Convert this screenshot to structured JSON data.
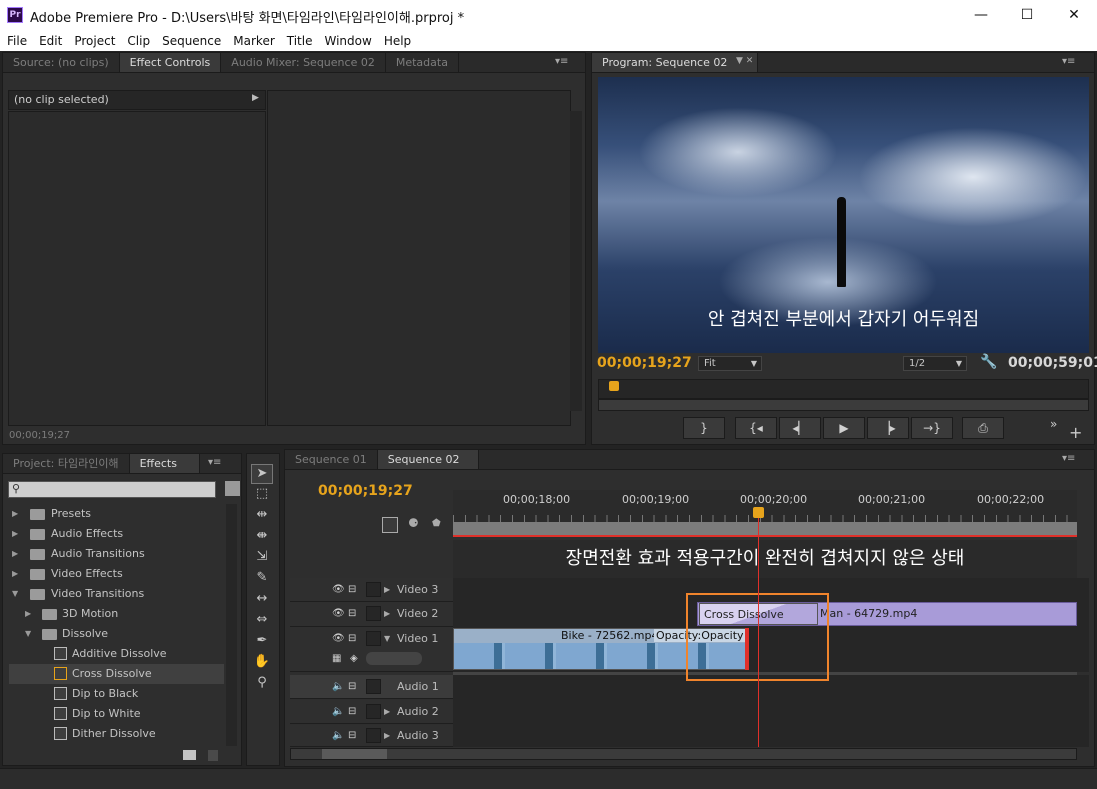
{
  "window": {
    "app_icon": "Pr",
    "title": "Adobe Premiere Pro - D:\\Users\\바탕 화면\\타임라인\\타임라인이해.prproj *",
    "minimize": "—",
    "maximize": "☐",
    "close": "✕"
  },
  "menu": [
    "File",
    "Edit",
    "Project",
    "Clip",
    "Sequence",
    "Marker",
    "Title",
    "Window",
    "Help"
  ],
  "source_panel": {
    "tabs": [
      "Source: (no clips)",
      "Effect Controls",
      "Audio Mixer: Sequence 02",
      "Metadata"
    ],
    "active_tab": "Effect Controls",
    "clip_label": "(no clip selected)",
    "timecode": "00;00;19;27"
  },
  "program": {
    "tab": "Program: Sequence 02",
    "caption": "안 겹쳐진 부분에서 갑자기 어두워짐",
    "current_tc": "00;00;19;27",
    "zoom": "Fit",
    "resolution": "1/2",
    "duration_tc": "00;00;59;01"
  },
  "project_panel": {
    "tabs": [
      "Project: 타임라인이해",
      "Effects"
    ],
    "active_tab": "Effects",
    "tree": [
      {
        "label": "Presets",
        "level": 0,
        "type": "folder",
        "expanded": false
      },
      {
        "label": "Audio Effects",
        "level": 0,
        "type": "folder",
        "expanded": false
      },
      {
        "label": "Audio Transitions",
        "level": 0,
        "type": "folder",
        "expanded": false
      },
      {
        "label": "Video Effects",
        "level": 0,
        "type": "folder",
        "expanded": false
      },
      {
        "label": "Video Transitions",
        "level": 0,
        "type": "folder",
        "expanded": true
      },
      {
        "label": "3D Motion",
        "level": 1,
        "type": "folder",
        "expanded": false
      },
      {
        "label": "Dissolve",
        "level": 1,
        "type": "folder",
        "expanded": true
      },
      {
        "label": "Additive Dissolve",
        "level": 2,
        "type": "item"
      },
      {
        "label": "Cross Dissolve",
        "level": 2,
        "type": "item",
        "selected": true
      },
      {
        "label": "Dip to Black",
        "level": 2,
        "type": "item"
      },
      {
        "label": "Dip to White",
        "level": 2,
        "type": "item"
      },
      {
        "label": "Dither Dissolve",
        "level": 2,
        "type": "item"
      }
    ]
  },
  "timeline": {
    "tabs": [
      "Sequence 01",
      "Sequence 02"
    ],
    "active_tab": "Sequence 02",
    "timecode": "00;00;19;27",
    "ruler": [
      "00;00;18;00",
      "00;00;19;00",
      "00;00;20;00",
      "00;00;21;00",
      "00;00;22;00"
    ],
    "annotation": "장면전환 효과 적용구간이 완전히 겹쳐지지 않은 상태",
    "tracks": {
      "video3": "Video 3",
      "video2": "Video 2",
      "video1": "Video 1",
      "audio1": "Audio 1",
      "audio2": "Audio 2",
      "audio3": "Audio 3"
    },
    "clips": {
      "transition": "Cross Dissolve",
      "man": "Man - 64729.mp4",
      "bike": "Bike - 72562.mp4",
      "opacity": "Opacity:Opacity"
    }
  },
  "icons": [
    "search-icon",
    "eye-icon",
    "folder-icon",
    "play-icon",
    "step-back-icon",
    "step-forward-icon",
    "wrench-icon",
    "selection-tool-icon",
    "razor-tool-icon",
    "hand-tool-icon",
    "zoom-tool-icon",
    "pen-tool-icon",
    "speaker-icon",
    "new-bin-icon",
    "trash-icon"
  ],
  "colors": {
    "accent_timecode": "#e7a41c",
    "bg": "#232323",
    "panel": "#2e2e2e",
    "clip_video2": "#a89bd8",
    "transition_box": "#f0842c",
    "playhead": "#e0302a"
  }
}
